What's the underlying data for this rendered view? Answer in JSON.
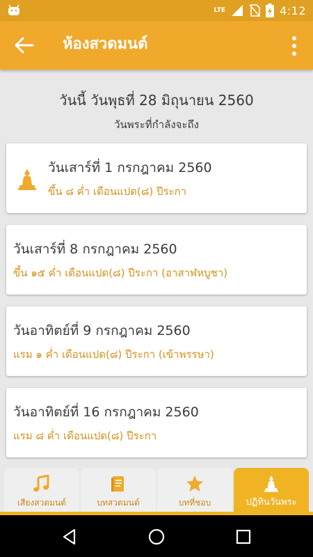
{
  "status_bar": {
    "network_label": "LTE",
    "time": "4:12"
  },
  "app_bar": {
    "title": "ห้องสวดมนต์"
  },
  "header": {
    "today": "วันนี้ วันพุธที่ 28 มิถุนายน 2560",
    "subtitle": "วันพระที่กำลังจะถึง"
  },
  "cards": [
    {
      "title": "วันเสาร์ที่ 1 กรกฎาคม 2560",
      "subtitle": "ขึ้น ๘ ค่ำ เดือนแปด(๘) ปีระกา"
    },
    {
      "title": "วันเสาร์ที่ 8 กรกฎาคม 2560",
      "subtitle": "ขึ้น ๑๕ ค่ำ เดือนแปด(๘) ปีระกา (อาสาฬหบูชา)"
    },
    {
      "title": "วันอาทิตย์ที่ 9 กรกฎาคม 2560",
      "subtitle": "แรม ๑ ค่ำ เดือนแปด(๘) ปีระกา (เข้าพรรษา)"
    },
    {
      "title": "วันอาทิตย์ที่ 16 กรกฎาคม 2560",
      "subtitle": "แรม ๘ ค่ำ เดือนแปด(๘) ปีระกา"
    }
  ],
  "bottom_nav": {
    "tabs": [
      {
        "label": "เสียงสวดมนต์",
        "icon": "music-note-icon"
      },
      {
        "label": "บทสวดมนต์",
        "icon": "book-icon"
      },
      {
        "label": "บทที่ชอบ",
        "icon": "star-icon"
      },
      {
        "label": "ปฏิทินวันพระ",
        "icon": "buddha-icon"
      }
    ],
    "active_index": 3
  },
  "colors": {
    "status_bar": "#e0a021",
    "app_bar": "#f0a92a",
    "accent_text": "#d4921c",
    "active_tab": "#f0b323"
  }
}
